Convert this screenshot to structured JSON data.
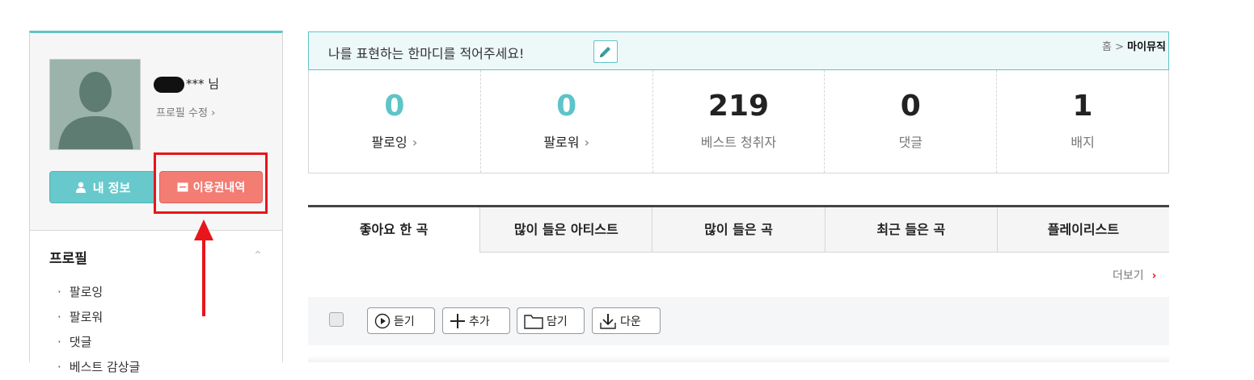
{
  "profile": {
    "username_suffix": "*** 님",
    "edit_label": "프로필 수정",
    "chevron": "›",
    "myinfo_label": "내 정보",
    "ticket_label": "이용권내역"
  },
  "sidebar": {
    "title": "프로필",
    "collapse_glyph": "⌃",
    "items": [
      {
        "label": "팔로잉"
      },
      {
        "label": "팔로워"
      },
      {
        "label": "댓글"
      },
      {
        "label": "베스트 감상글"
      }
    ]
  },
  "status": {
    "text": "나를 표현하는 한마디를 적어주세요!",
    "breadcrumb_home": "홈",
    "breadcrumb_sep": ">",
    "breadcrumb_current": "마이뮤직"
  },
  "stats": [
    {
      "value": "0",
      "label": "팔로잉"
    },
    {
      "value": "0",
      "label": "팔로워"
    },
    {
      "value": "219",
      "label": "베스트 청취자"
    },
    {
      "value": "0",
      "label": "댓글"
    },
    {
      "value": "1",
      "label": "배지"
    }
  ],
  "tabs": [
    {
      "label": "좋아요 한 곡"
    },
    {
      "label": "많이 들은 아티스트"
    },
    {
      "label": "많이 들은 곡"
    },
    {
      "label": "최근 들은 곡"
    },
    {
      "label": "플레이리스트"
    }
  ],
  "more_label": "더보기",
  "toolbar": {
    "play_label": "듣기",
    "add_label": "추가",
    "save_label": "담기",
    "download_label": "다운"
  },
  "colors": {
    "accent_teal": "#5ec4c8",
    "ticket_red": "#f37c73",
    "highlight_red": "#e8151b"
  },
  "icons": [
    "person-icon",
    "ticket-icon",
    "pencil-icon",
    "play-icon",
    "plus-icon",
    "folder-icon",
    "download-icon"
  ]
}
